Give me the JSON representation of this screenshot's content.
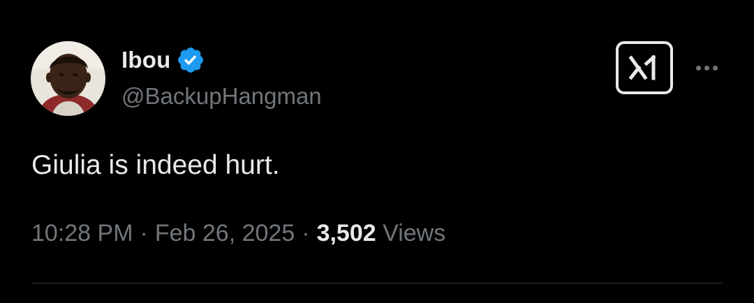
{
  "author": {
    "display_name": "Ibou",
    "handle": "@BackupHangman",
    "verified": true
  },
  "icons": {
    "verified": "verified-badge-icon",
    "grok": "grok-icon",
    "more": "more-options-icon"
  },
  "tweet": {
    "text": "Giulia is indeed hurt.",
    "time": "10:28 PM",
    "date": "Feb 26, 2025",
    "separator": "·",
    "views_count": "3,502",
    "views_label": "Views"
  },
  "colors": {
    "background": "#000000",
    "primary_text": "#e7e9ea",
    "secondary_text": "#71767b",
    "verified_blue": "#1d9bf0",
    "divider": "#2f3336"
  }
}
